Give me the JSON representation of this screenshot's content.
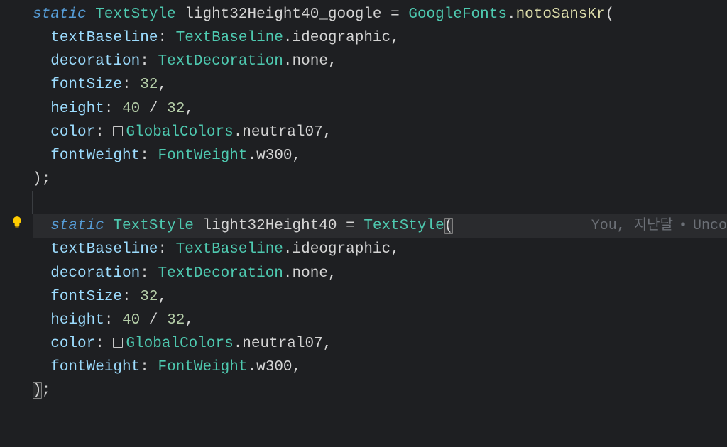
{
  "block1": {
    "kw_static": "static",
    "type_TextStyle": "TextStyle",
    "varName": "light32Height40_google",
    "eq": "=",
    "rhs_class": "GoogleFonts",
    "dot": ".",
    "rhs_method": "notoSansKr",
    "open": "(",
    "args": {
      "textBaseline_label": "textBaseline",
      "colon": ":",
      "TextBaseline": "TextBaseline",
      "ideographic": "ideographic",
      "decoration_label": "decoration",
      "TextDecoration": "TextDecoration",
      "none": "none",
      "fontSize_label": "fontSize",
      "fontSize_val": "32",
      "height_label": "height",
      "height_a": "40",
      "slash": "/",
      "height_b": "32",
      "color_label": "color",
      "GlobalColors": "GlobalColors",
      "neutral07": "neutral07",
      "fontWeight_label": "fontWeight",
      "FontWeight": "FontWeight",
      "w300": "w300",
      "comma": ","
    },
    "close": ");"
  },
  "block2": {
    "kw_static": "static",
    "type_TextStyle": "TextStyle",
    "varName": "light32Height40",
    "eq": "=",
    "rhs_class": "TextStyle",
    "open": "(",
    "args": {
      "textBaseline_label": "textBaseline",
      "colon": ":",
      "TextBaseline": "TextBaseline",
      "ideographic": "ideographic",
      "decoration_label": "decoration",
      "TextDecoration": "TextDecoration",
      "none": "none",
      "fontSize_label": "fontSize",
      "fontSize_val": "32",
      "height_label": "height",
      "height_a": "40",
      "slash": "/",
      "height_b": "32",
      "color_label": "color",
      "GlobalColors": "GlobalColors",
      "neutral07": "neutral07",
      "fontWeight_label": "fontWeight",
      "FontWeight": "FontWeight",
      "w300": "w300",
      "comma": ","
    },
    "close_br": ")",
    "close_semi": ";"
  },
  "blame": {
    "author": "You",
    "comma": ", ",
    "when": "지난달",
    "bullet": "•",
    "msg": "Unco"
  }
}
